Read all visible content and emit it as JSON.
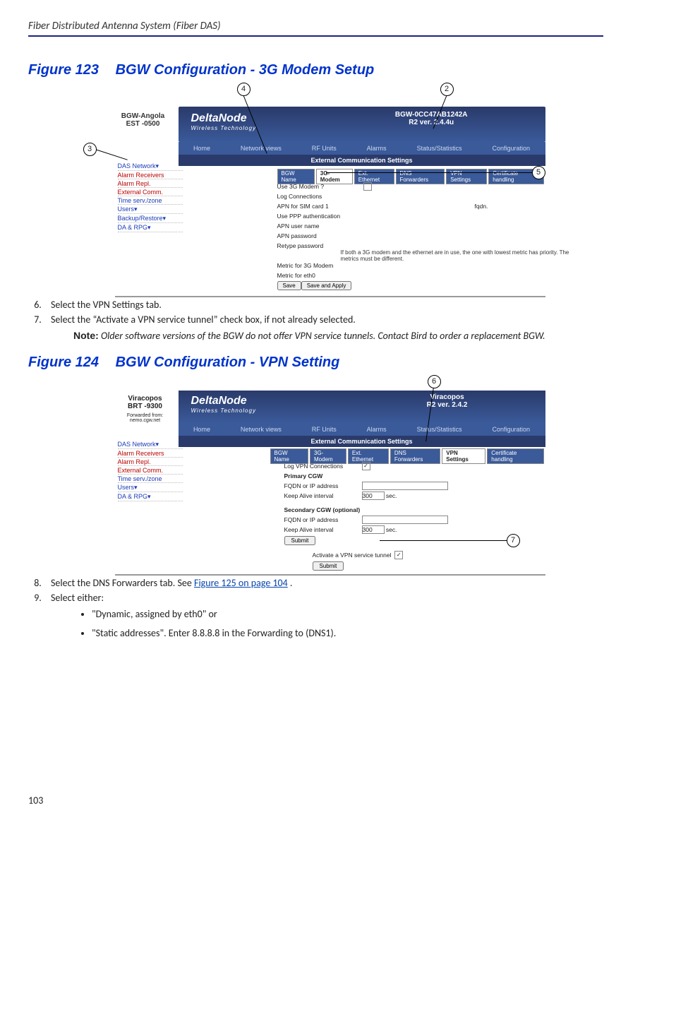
{
  "header": {
    "title": "Fiber Distributed Antenna System (Fiber DAS)"
  },
  "fig123": {
    "num": "Figure 123",
    "title": "BGW Configuration - 3G Modem Setup",
    "callouts": {
      "c2": "2",
      "c3": "3",
      "c4": "4",
      "c5": "5"
    },
    "device": {
      "name": "BGW-Angola",
      "tz": "EST -0500"
    },
    "brand": "DeltaNode",
    "brand_sub": "Wireless Technology",
    "bhead1": "BGW-0CC47AB1242A",
    "bhead2": "R2 ver. 2.4.4u",
    "nav": [
      "Home",
      "Network views",
      "RF Units",
      "Alarms",
      "Status/Statistics",
      "Configuration"
    ],
    "ribbon": "External Communication Settings",
    "tabs": [
      "BGW Name",
      "3G-Modem",
      "Ext. Ethernet",
      "DNS Forwarders",
      "VPN Settings",
      "Certificate handling"
    ],
    "active_tab": "3G-Modem",
    "sidebar": [
      "DAS Network▾",
      "Alarm Receivers",
      "Alarm Repl.",
      "External Comm.",
      "Time serv./zone",
      "Users▾",
      "Backup/Restore▾",
      "DA & RPG▾"
    ],
    "rows": {
      "use3g": "Use 3G Modem ?",
      "logc": "Log Connections",
      "apn1": "APN for SIM card 1",
      "apn1v": "fqdn.",
      "ppp": "Use PPP authentication",
      "apnu": "APN user name",
      "apnp": "APN password",
      "retp": "Retype password",
      "note": "If both a 3G modem and the ethernet are in use, the one with lowest metric has priority. The metrics must be different.",
      "m3g": "Metric for 3G Modem",
      "meth": "Metric for eth0",
      "save": "Save",
      "savea": "Save and Apply"
    }
  },
  "steps67": {
    "s6": "Select the VPN Settings tab.",
    "s7": "Select the “Activate a VPN service tunnel” check box, if not already selected."
  },
  "noteA": {
    "label": "Note:",
    "text": "Older software versions of the BGW do not offer VPN service tunnels. Contact Bird to order a replacement BGW."
  },
  "fig124": {
    "num": "Figure 124",
    "title": "BGW Configuration - VPN Setting",
    "callouts": {
      "c6": "6",
      "c7": "7"
    },
    "device": {
      "name": "Viracopos",
      "tz": "BRT -9300"
    },
    "fwd": "Forwarded from: nemo.cgw.net",
    "brand": "DeltaNode",
    "brand_sub": "Wireless Technology",
    "bhead1": "Viracopos",
    "bhead2": "R2 ver. 2.4.2",
    "nav": [
      "Home",
      "Network views",
      "RF Units",
      "Alarms",
      "Status/Statistics",
      "Configuration"
    ],
    "ribbon": "External Communication Settings",
    "tabs": [
      "BGW Name",
      "3G-Modem",
      "Ext. Ethernet",
      "DNS Forwarders",
      "VPN Settings",
      "Certificate handling"
    ],
    "active_tab": "VPN Settings",
    "sidebar": [
      "DAS Network▾",
      "Alarm Receivers",
      "Alarm Repl.",
      "External Comm.",
      "Time serv./zone",
      "Users▾",
      "DA & RPG▾"
    ],
    "rows": {
      "logv": "Log VPN Connections",
      "pcgw": "Primary CGW",
      "fqdn": "FQDN or IP address",
      "kai": "Keep Alive interval",
      "kaiv": "300",
      "sec": "sec.",
      "scgw": "Secondary CGW (optional)",
      "sub": "Submit",
      "act": "Activate a VPN service tunnel"
    }
  },
  "steps89": {
    "s8a": "Select the DNS Forwarders tab. See ",
    "s8link": "Figure 125 on page 104",
    "s8b": ".",
    "s9": "Select either:"
  },
  "bul": {
    "b1": "\"Dynamic, assigned by eth0\" or",
    "b2": "\"Static addresses\".  Enter 8.8.8.8 in the Forwarding to (DNS1)."
  },
  "pagenum": "103"
}
